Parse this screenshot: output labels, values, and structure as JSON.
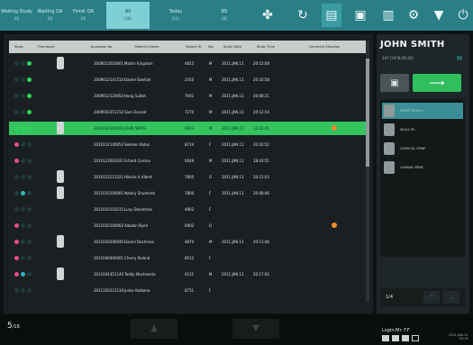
{
  "tabs": [
    {
      "label": "Waiting Study",
      "count": "(0)"
    },
    {
      "label": "Waiting QA",
      "count": "(0)"
    },
    {
      "label": "Finish QA",
      "count": "(0)"
    },
    {
      "label": "All",
      "count": "(28)"
    },
    {
      "label": "Today",
      "count": "(11)"
    },
    {
      "label": "BS",
      "count": "(8)"
    }
  ],
  "toolbar_icons": [
    "add-patient-icon",
    "refresh-icon",
    "monitor-icon",
    "lock-icon",
    "delete-icon",
    "settings-icon",
    "dropdown-icon",
    "power-icon"
  ],
  "columns": [
    "Study Condition",
    "Thumbnail",
    "Accession No.",
    "Patient's Name",
    "Patient ID",
    "Sex",
    "Study Date",
    "Study Time",
    "Comment Situation"
  ],
  "rows": [
    {
      "status": [
        "#1f3b3c",
        "#1f3b3c",
        "#2fd35f"
      ],
      "acc": "2008012010001",
      "name": "Martin Kingston",
      "pid": "4815",
      "sex": "M",
      "date": "2011.JAN.11",
      "time": "20:15:08",
      "thumb": true
    },
    {
      "status": [
        "#1f3b3c",
        "#1f3b3c",
        "#2fd35f"
      ],
      "acc": "2009012141514",
      "name": "Daniel Swefzel",
      "pid": "2450",
      "sex": "M",
      "date": "2011.JAN.11",
      "time": "20:16:58",
      "thumb": false
    },
    {
      "status": [
        "#1f3b3c",
        "#1f3b3c",
        "#2fd35f"
      ],
      "acc": "2009012124854",
      "name": "Hong Sullah",
      "pid": "7001",
      "sex": "M",
      "date": "2011.JAN.11",
      "time": "20:08:21",
      "thumb": false
    },
    {
      "status": [
        "#1f3b3c",
        "#1f3b3c",
        "#2fd35f"
      ],
      "acc": "2009043351212",
      "name": "Sam Donald",
      "pid": "7270",
      "sex": "M",
      "date": "2011.JAN.11",
      "time": "20:12:54",
      "thumb": false
    },
    {
      "status": [
        "#2fd35f",
        "#2fd35f",
        "#2fd35f"
      ],
      "acc": "2010020100021",
      "name": "JOHN SMITH",
      "pid": "0023",
      "sex": "M",
      "date": "2011.JAN.11",
      "time": "12:21:41",
      "thumb": true,
      "selected": true,
      "flag": true
    },
    {
      "status": [
        "#e74b8c",
        "#1f3b3c",
        "#1f3b3c"
      ],
      "acc": "2010112100054",
      "name": "Selesen Rotus",
      "pid": "8724",
      "sex": "F",
      "date": "2011.JAN.11",
      "time": "20:02:52",
      "thumb": false
    },
    {
      "status": [
        "#e74b8c",
        "#1f3b3c",
        "#1f3b3c"
      ],
      "acc": "2010122001021",
      "name": "Erhard Corona",
      "pid": "0049",
      "sex": "M",
      "date": "2011.JAN.11",
      "time": "18:43:51",
      "thumb": false
    },
    {
      "status": [
        "#1f3b3c",
        "#1f3b3c",
        "#1f3b3c"
      ],
      "acc": "2010122211521",
      "name": "Hikorls A Albert",
      "pid": "7800",
      "sex": "O",
      "date": "2011.JAN.11",
      "time": "20:12:03",
      "thumb": true
    },
    {
      "status": [
        "#1f3b3c",
        "#2fb7c0",
        "#1f3b3c"
      ],
      "acc": "2011010100001",
      "name": "Natary Shumertz",
      "pid": "7800",
      "sex": "F",
      "date": "2011.JAN.11",
      "time": "20:08:46",
      "thumb": true
    },
    {
      "status": [
        "#1f3b3c",
        "#1f3b3c",
        "#1f3b3c"
      ],
      "acc": "2011010110215",
      "name": "Lucy Donelman",
      "pid": "4802",
      "sex": "F",
      "date": "",
      "time": "",
      "thumb": false
    },
    {
      "status": [
        "#e74b8c",
        "#1f3b3c",
        "#1f3b3c"
      ],
      "acc": "2011020100002",
      "name": "Alkadin Byerl",
      "pid": "0002",
      "sex": "O",
      "date": "",
      "time": "",
      "thumb": false,
      "orange": true
    },
    {
      "status": [
        "#e74b8c",
        "#1f3b3c",
        "#1f3b3c"
      ],
      "acc": "2011020200040",
      "name": "Daniel Dochman",
      "pid": "4870",
      "sex": "M",
      "date": "2011.JAN.11",
      "time": "20:13:46",
      "thumb": true
    },
    {
      "status": [
        "#e74b8c",
        "#1f3b3c",
        "#1f3b3c"
      ],
      "acc": "2011040400001",
      "name": "Cherry Roland",
      "pid": "8512",
      "sex": "F",
      "date": "",
      "time": "",
      "thumb": false
    },
    {
      "status": [
        "#e74b8c",
        "#2fb7c0",
        "#1f3b3c"
      ],
      "acc": "2011041451140",
      "name": "Teddy Macheenie",
      "pid": "4121",
      "sex": "M",
      "date": "2011.JAN.11",
      "time": "20:17:02",
      "thumb": true
    },
    {
      "status": [
        "#1f3b3c",
        "#1f3b3c",
        "#1f3b3c"
      ],
      "acc": "2011320212134",
      "name": "Junko Kodama",
      "pid": "8751",
      "sex": "F",
      "date": "",
      "time": "",
      "thumb": false
    }
  ],
  "patient": {
    "name": "JOHN SMITH",
    "info": "34Y   (1978.09.20)",
    "badge": "M"
  },
  "series": [
    {
      "label": "CHEST PA A+L",
      "selected": true
    },
    {
      "label": "SKULL PA",
      "selected": false
    },
    {
      "label": "CERVICAL SPINE",
      "selected": false
    },
    {
      "label": "LUMBAR SPINE",
      "selected": false
    }
  ],
  "pager": {
    "page": "1/4"
  },
  "count": {
    "current": "5",
    "total": "/18"
  },
  "login": "Login:Mr. F.F",
  "clock": {
    "date": "2011.JAN.11",
    "time": "20:19"
  }
}
